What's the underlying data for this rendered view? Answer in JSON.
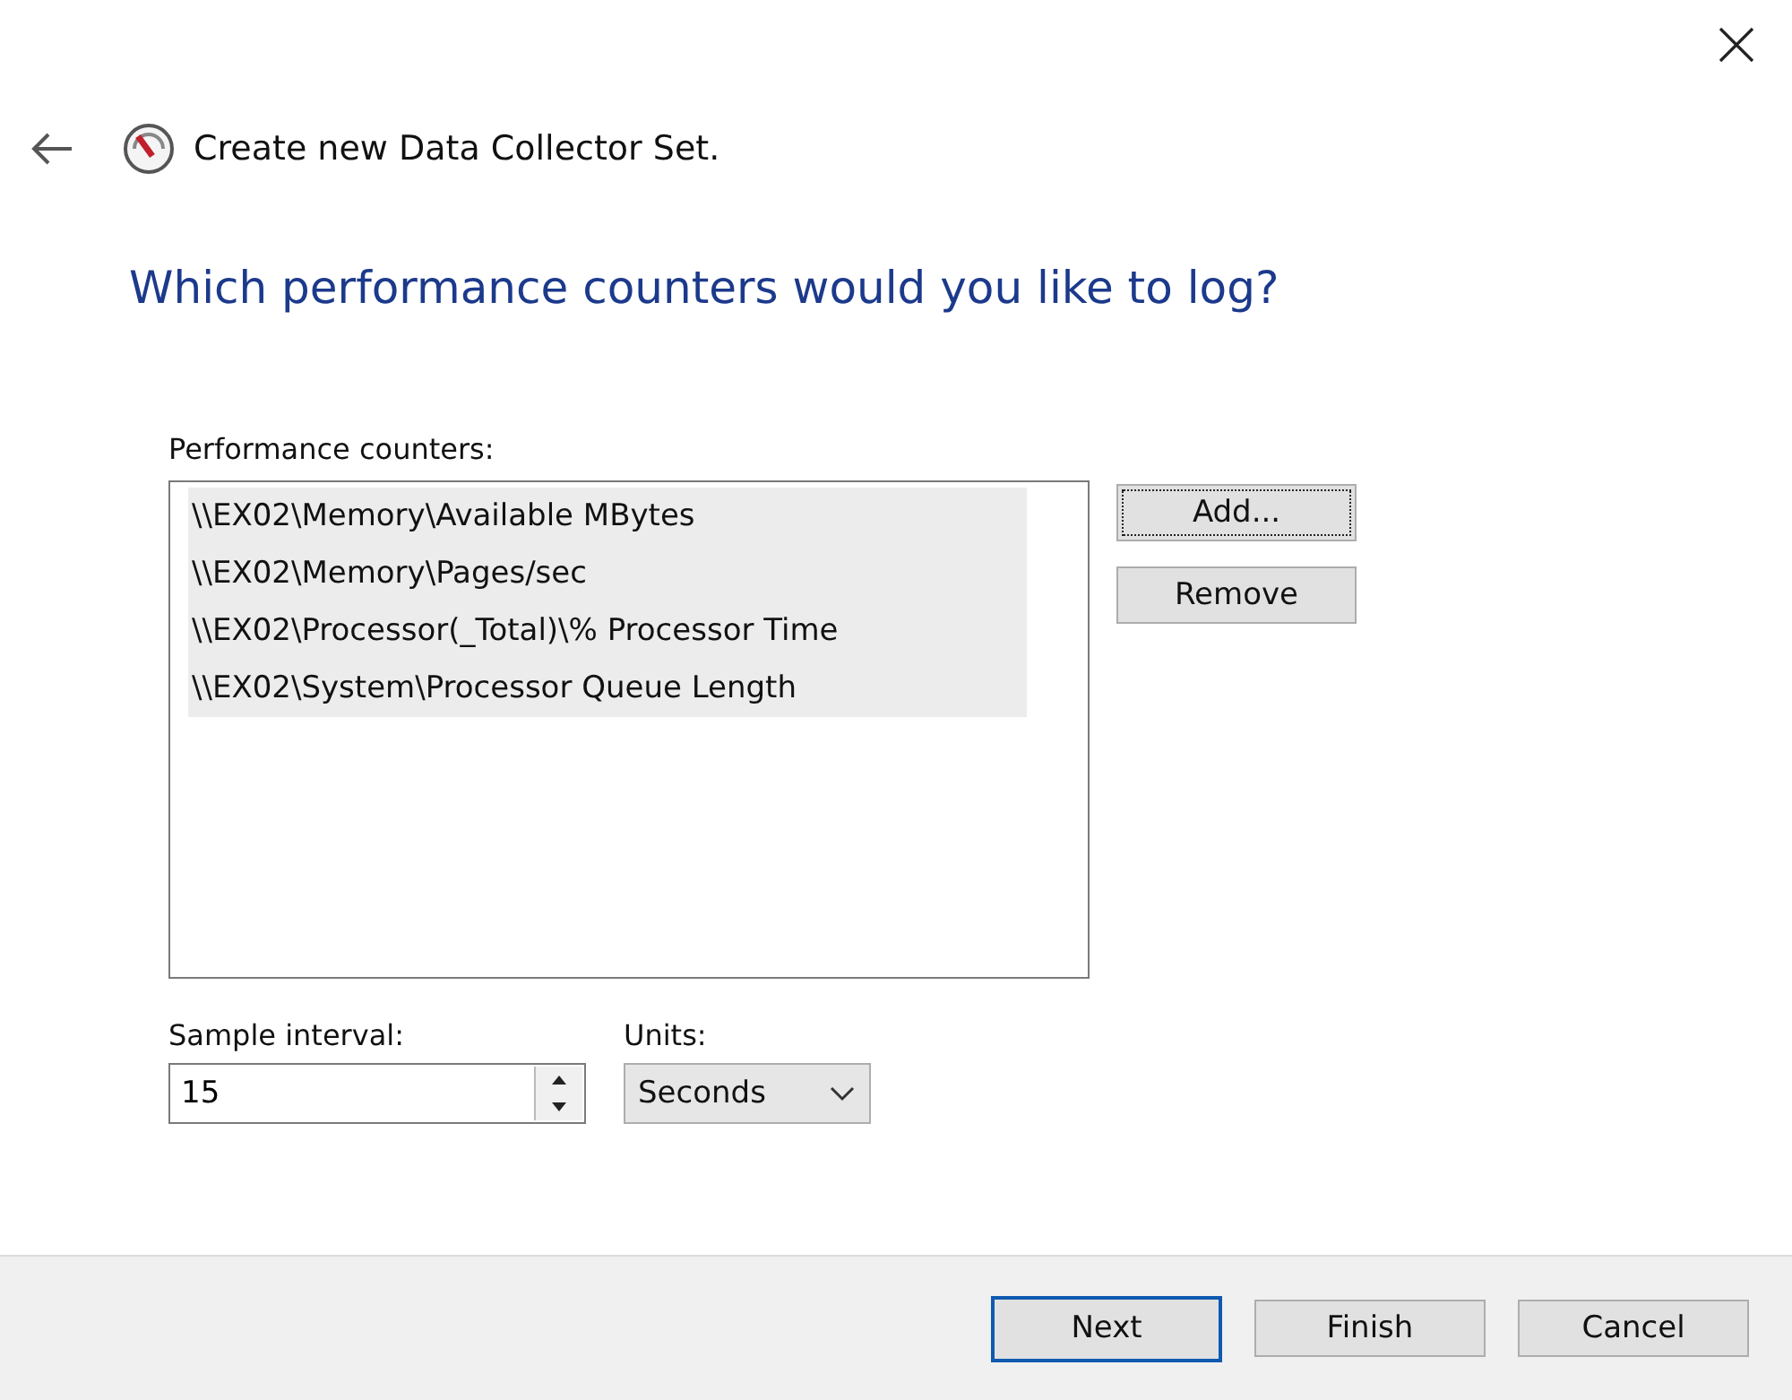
{
  "window": {
    "title": "Create new Data Collector Set."
  },
  "heading": "Which performance counters would you like to log?",
  "counters": {
    "label": "Performance counters:",
    "items": [
      {
        "text": "\\\\EX02\\Memory\\Available MBytes",
        "selected": true
      },
      {
        "text": "\\\\EX02\\Memory\\Pages/sec",
        "selected": true
      },
      {
        "text": "\\\\EX02\\Processor(_Total)\\% Processor Time",
        "selected": true
      },
      {
        "text": "\\\\EX02\\System\\Processor Queue Length",
        "selected": true
      }
    ]
  },
  "side_buttons": [
    {
      "label": "Add...",
      "focused": true
    },
    {
      "label": "Remove",
      "focused": false
    }
  ],
  "sample_interval": {
    "label": "Sample interval:",
    "value": "15"
  },
  "units": {
    "label": "Units:",
    "value": "Seconds"
  },
  "footer_buttons": [
    {
      "label": "Next",
      "default": true
    },
    {
      "label": "Finish",
      "default": false
    },
    {
      "label": "Cancel",
      "default": false
    }
  ]
}
